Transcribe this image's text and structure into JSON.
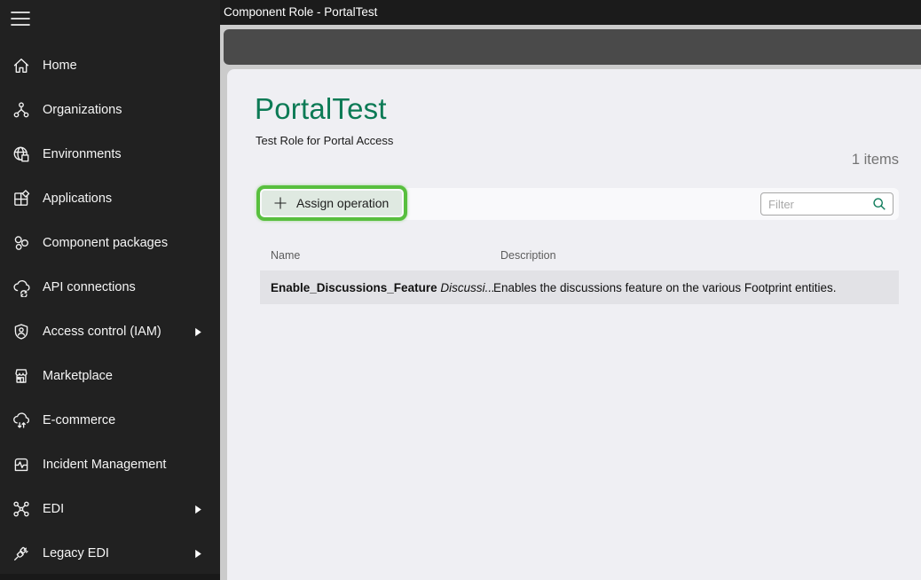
{
  "titlebar": {
    "title": "Component Role - PortalTest"
  },
  "sidebar": {
    "items": [
      {
        "label": "Home",
        "icon": "home-icon",
        "chevron": false
      },
      {
        "label": "Organizations",
        "icon": "organizations-icon",
        "chevron": false
      },
      {
        "label": "Environments",
        "icon": "environments-icon",
        "chevron": false
      },
      {
        "label": "Applications",
        "icon": "applications-icon",
        "chevron": false
      },
      {
        "label": "Component packages",
        "icon": "component-packages-icon",
        "chevron": false
      },
      {
        "label": "API connections",
        "icon": "api-connections-icon",
        "chevron": false
      },
      {
        "label": "Access control (IAM)",
        "icon": "access-control-icon",
        "chevron": true
      },
      {
        "label": "Marketplace",
        "icon": "marketplace-icon",
        "chevron": false
      },
      {
        "label": "E-commerce",
        "icon": "ecommerce-icon",
        "chevron": false
      },
      {
        "label": "Incident Management",
        "icon": "incident-management-icon",
        "chevron": false
      },
      {
        "label": "EDI",
        "icon": "edi-icon",
        "chevron": true
      },
      {
        "label": "Legacy EDI",
        "icon": "legacy-edi-icon",
        "chevron": true
      }
    ]
  },
  "page": {
    "title": "PortalTest",
    "subtitle": "Test Role for Portal Access",
    "items_count": "1 items",
    "assign_button_label": "Assign operation",
    "filter_placeholder": "Filter"
  },
  "table": {
    "columns": {
      "name": "Name",
      "description": "Description"
    },
    "rows": [
      {
        "name_primary": "Enable_Discussions_Feature",
        "name_secondary": "Discussi...",
        "description": "Enables the discussions feature on the various Footprint entities."
      }
    ]
  },
  "icons": {
    "menu": "hamburger-icon",
    "search": "search-icon",
    "add": "plus-icon",
    "expand": "chevron-right-icon"
  },
  "colors": {
    "titlebar_bg": "#1b1b1b",
    "sidebar_bg": "#212121",
    "gutter_bg": "#cbcbcb",
    "cmdbar_bg": "#4a4a4a",
    "panel_bg": "#efeff3",
    "accent_green": "#0c7a55",
    "highlight_green": "#58bf3e",
    "button_bg": "#dfe9e1",
    "row_bg": "#e2e2e6"
  }
}
